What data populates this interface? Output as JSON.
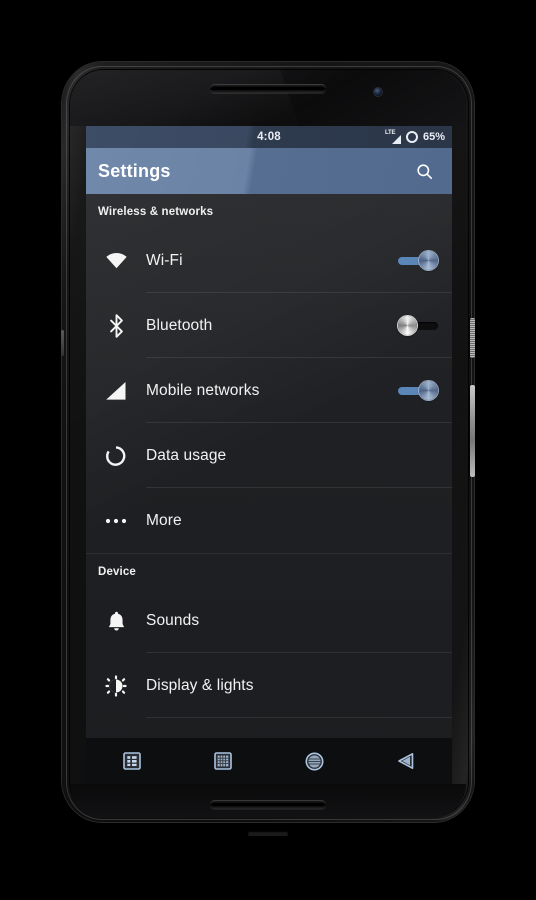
{
  "device": {
    "frame_color": "#121212",
    "earpiece": "earpiece-speaker",
    "camera": "front-camera"
  },
  "status_bar": {
    "time": "4:08",
    "battery_percent": "65%",
    "network_label": "LTE",
    "icons": [
      "lte-signal-icon",
      "battery-circle-icon"
    ],
    "background": "#2e3a4e"
  },
  "action_bar": {
    "title": "Settings",
    "search_icon": "search-icon",
    "background": "#5a7296"
  },
  "sections": [
    {
      "header": "Wireless & networks",
      "rows": [
        {
          "label": "Wi-Fi",
          "icon": "wifi-icon",
          "control": "switch",
          "state": "on"
        },
        {
          "label": "Bluetooth",
          "icon": "bluetooth-icon",
          "control": "switch",
          "state": "off"
        },
        {
          "label": "Mobile networks",
          "icon": "signal-icon",
          "control": "switch",
          "state": "on"
        },
        {
          "label": "Data usage",
          "icon": "data-usage-icon",
          "control": "none",
          "state": ""
        },
        {
          "label": "More",
          "icon": "more-dots-icon",
          "control": "none",
          "state": ""
        }
      ]
    },
    {
      "header": "Device",
      "rows": [
        {
          "label": "Sounds",
          "icon": "bell-icon",
          "control": "none",
          "state": ""
        },
        {
          "label": "Display & lights",
          "icon": "brightness-icon",
          "control": "none",
          "state": ""
        }
      ]
    }
  ],
  "nav_bar": {
    "buttons": [
      {
        "name": "menu-button",
        "icon": "menu-icon"
      },
      {
        "name": "recents-button",
        "icon": "square-icon"
      },
      {
        "name": "home-button",
        "icon": "circle-icon"
      },
      {
        "name": "back-button",
        "icon": "triangle-back-icon"
      }
    ]
  },
  "colors": {
    "accent_blue": "#5a86b8",
    "action_bar": "#5a7296",
    "status_bar": "#2e3a4e",
    "list_background": "#1e2023",
    "text_primary": "#f2f2f2"
  }
}
